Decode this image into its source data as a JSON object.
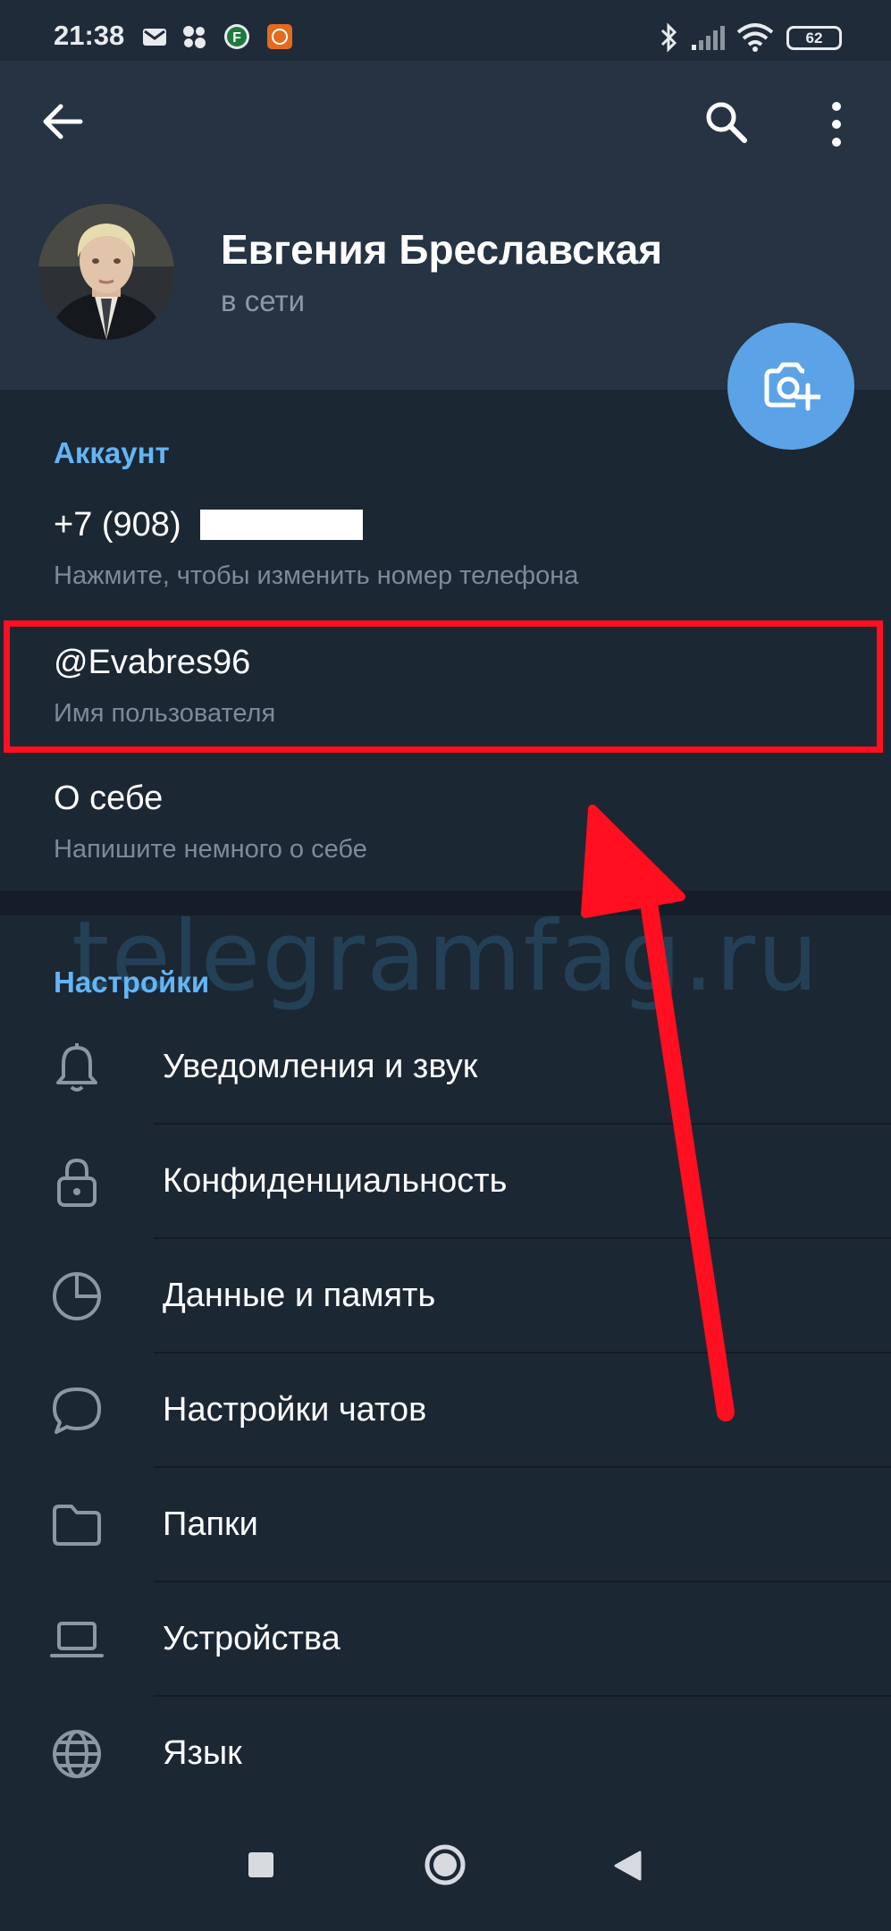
{
  "status_bar": {
    "time": "21:38",
    "notification_icons": [
      "mail-icon",
      "dots-app-icon",
      "f-app-icon",
      "mi-app-icon"
    ],
    "system_icons": [
      "bluetooth-icon",
      "signal-icon",
      "wifi-icon"
    ],
    "battery": "62"
  },
  "header": {
    "icons": [
      "back-arrow-icon",
      "search-icon",
      "more-vertical-icon"
    ],
    "name": "Евгения Бреславская",
    "status": "в сети",
    "fab_icon": "add-photo-icon"
  },
  "account": {
    "title": "Аккаунт",
    "phone": {
      "value": "+7 (908)",
      "hint": "Нажмите, чтобы изменить номер телефона"
    },
    "username": {
      "value": "@Evabres96",
      "hint": "Имя пользователя"
    },
    "bio": {
      "value": "О себе",
      "hint": "Напишите немного о себе"
    }
  },
  "settings": {
    "title": "Настройки",
    "items": [
      {
        "label": "Уведомления и звук",
        "icon": "bell-icon"
      },
      {
        "label": "Конфиденциальность",
        "icon": "lock-icon"
      },
      {
        "label": "Данные и память",
        "icon": "pie-chart-icon"
      },
      {
        "label": "Настройки чатов",
        "icon": "chat-bubble-icon"
      },
      {
        "label": "Папки",
        "icon": "folder-icon"
      },
      {
        "label": "Устройства",
        "icon": "laptop-icon"
      },
      {
        "label": "Язык",
        "icon": "globe-icon"
      }
    ]
  },
  "watermark": "telegramfag.ru",
  "nav_bar": {
    "icons": [
      "recents-square-icon",
      "home-circle-icon",
      "back-triangle-icon"
    ]
  },
  "colors": {
    "background": "#1c2734",
    "header": "#253342",
    "accent": "#64b5f6",
    "fab": "#5ba3e6",
    "annotation": "#ff0f1f"
  }
}
